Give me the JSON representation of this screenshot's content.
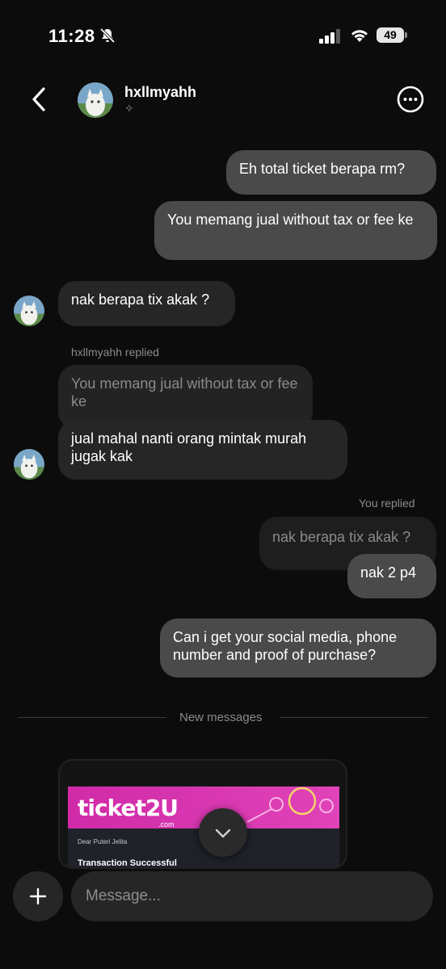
{
  "status_bar": {
    "time": "11:28",
    "battery": "49"
  },
  "header": {
    "name": "hxllmyahh",
    "sub_icon": "✧"
  },
  "messages": {
    "m1": "Eh total ticket berapa rm?",
    "m2": "You memang jual without tax or fee ke",
    "m3": "nak berapa tix akak ?",
    "reply1_label": "hxllmyahh replied",
    "reply1_quote": "You memang jual without tax or fee ke",
    "m4": "jual mahal nanti orang mintak murah jugak kak",
    "reply2_label": "You replied",
    "reply2_quote": "nak berapa tix akak ?",
    "m5": "nak 2 p4",
    "m6": "Can i get your social media, phone number and proof of purchase?"
  },
  "divider": {
    "label": "New messages"
  },
  "attachment": {
    "logo": "ticket2U",
    "logo_sub": ".com",
    "dear": "Dear Puteri Jelita",
    "title": "Transaction Successful"
  },
  "composer": {
    "placeholder": "Message..."
  },
  "colors": {
    "outgoing": "#4a4a4a",
    "incoming": "#262626",
    "background": "#0c0c0c",
    "brand": "#d02aa8"
  }
}
